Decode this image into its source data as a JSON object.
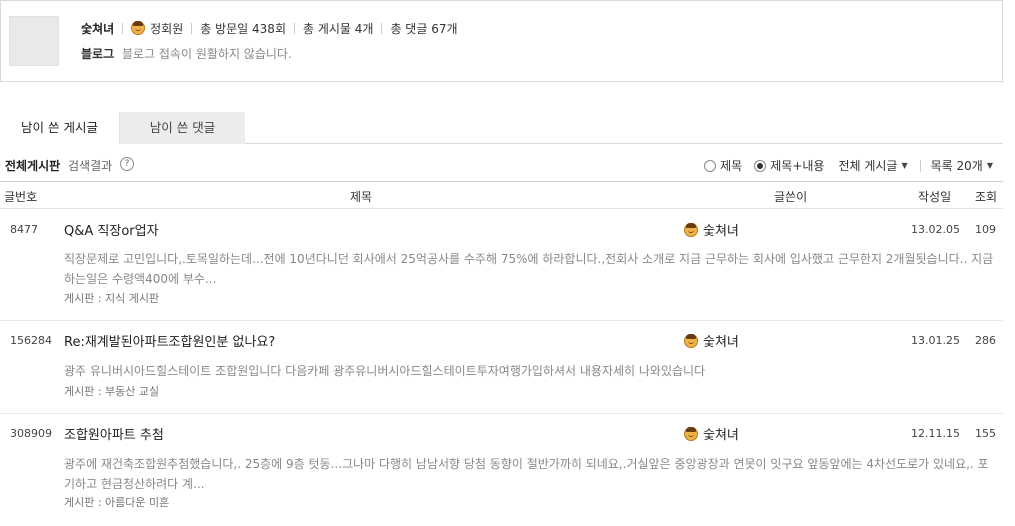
{
  "profile": {
    "nickname": "숯쳐녀",
    "grade": "정회원",
    "visits": "총 방문일 438회",
    "posts": "총 게시물 4개",
    "comments": "총 댓글 67개",
    "blog_label": "블로그",
    "blog_message": "블로그 접속이 원활하지 않습니다."
  },
  "tabs": [
    {
      "label": "남이 쓴 게시글",
      "active": true
    },
    {
      "label": "남이 쓴 댓글",
      "active": false
    }
  ],
  "board": {
    "title": "전체게시판",
    "subtitle": "검색결과",
    "help_icon": "?",
    "filter_title": "제목",
    "filter_title_content": "제목+내용",
    "filter_selected": "제목+내용",
    "board_select": "전체 게시글",
    "page_size": "목록 20개"
  },
  "columns": {
    "num": "글번호",
    "title": "제목",
    "author": "글쓴이",
    "date": "작성일",
    "views": "조회"
  },
  "rows": [
    {
      "num": "8477",
      "title": "Q&A 직장or업자",
      "author": "숯쳐녀",
      "date": "13.02.05",
      "views": "109",
      "snippet": "직장문제로 고민입니다,.토목일하는데...전에 10년다니던 회사에서 25억공사를 수주해 75%에 하라합니다.,전회사 소개로 지금 근무하는 회사에 입사했고 근무한지 2개월됫습니다.. 지금하는일은 수령액400에 부수...",
      "board": "게시판 : 지식 게시판"
    },
    {
      "num": "156284",
      "title": "Re:재계발된아파트조합원인분 없나요?",
      "author": "숯쳐녀",
      "date": "13.01.25",
      "views": "286",
      "snippet": "광주 유니버시아드힐스테이트 조합원입니다 다음카페 광주유니버시아드힐스테이트투자여행가입하셔서 내용자세히 나와있습니다",
      "board": "게시판 : 부동산 교실"
    },
    {
      "num": "308909",
      "title": "조합원아파트 추첨",
      "author": "숯쳐녀",
      "date": "12.11.15",
      "views": "155",
      "snippet": "광주에 재건축조합원추첨했습니다,. 25층에 9층 텃동...그나마 다행히 남남서향 당첨 동향이 절반가까히 되네요,.거실앞은 중앙광장과 연못이 잇구요 앞동앞에는 4차선도로가 있네요,. 포기하고 현금청산하려다 계...",
      "board": "게시판 : 아름다운 미혼"
    }
  ]
}
